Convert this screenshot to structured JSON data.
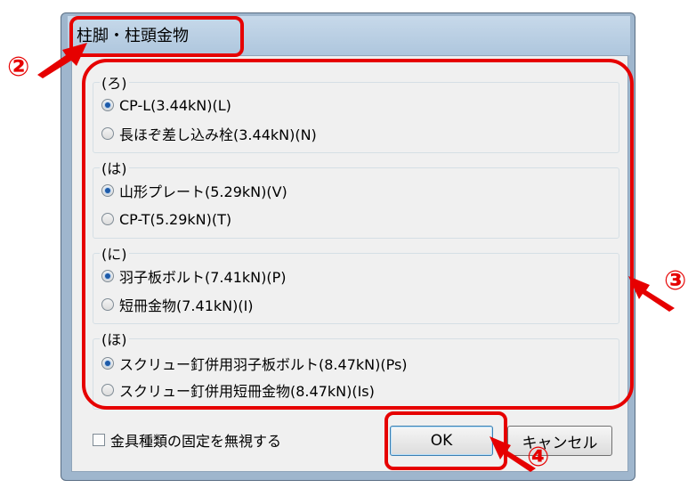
{
  "dialog": {
    "title": "柱脚・柱頭金物"
  },
  "groups": [
    {
      "label": "(ろ)",
      "options": [
        {
          "text": "CP-L(3.44kN)(L)",
          "selected": true
        },
        {
          "text": "長ほぞ差し込み栓(3.44kN)(N)",
          "selected": false
        }
      ]
    },
    {
      "label": "(は)",
      "options": [
        {
          "text": "山形プレート(5.29kN)(V)",
          "selected": true
        },
        {
          "text": "CP-T(5.29kN)(T)",
          "selected": false
        }
      ]
    },
    {
      "label": "(に)",
      "options": [
        {
          "text": "羽子板ボルト(7.41kN)(P)",
          "selected": true
        },
        {
          "text": "短冊金物(7.41kN)(I)",
          "selected": false
        }
      ]
    },
    {
      "label": "(ほ)",
      "options": [
        {
          "text": "スクリュー釘併用羽子板ボルト(8.47kN)(Ps)",
          "selected": true
        },
        {
          "text": "スクリュー釘併用短冊金物(8.47kN)(Is)",
          "selected": false
        }
      ]
    }
  ],
  "checkbox": {
    "label": "金具種類の固定を無視する",
    "checked": false
  },
  "buttons": {
    "ok": "OK",
    "cancel": "キャンセル"
  },
  "annotations": {
    "marker_2": "②",
    "marker_3": "③",
    "marker_4": "④",
    "color": "#e60000"
  }
}
